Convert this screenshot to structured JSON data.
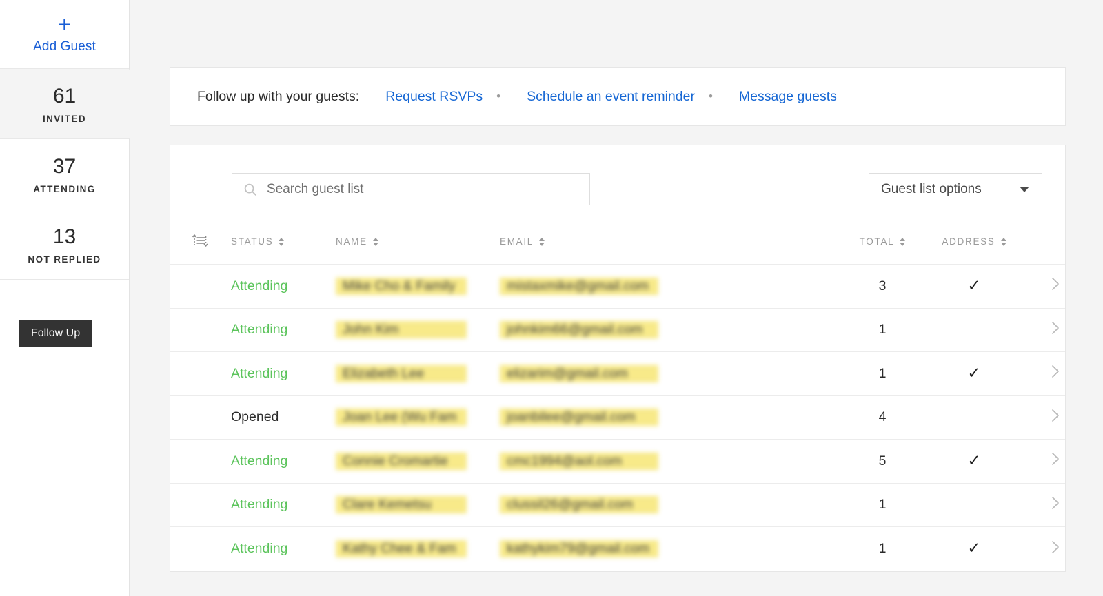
{
  "sidebar": {
    "add_guest": {
      "label": "Add Guest",
      "icon": "plus-icon",
      "color": "#1a5fd6"
    },
    "stats": [
      {
        "count": "61",
        "label": "INVITED",
        "active": true
      },
      {
        "count": "37",
        "label": "ATTENDING",
        "active": false
      },
      {
        "count": "13",
        "label": "NOT REPLIED",
        "active": false
      }
    ],
    "follow_up_button": "Follow Up"
  },
  "banner": {
    "prompt": "Follow up with your guests:",
    "separator": "•",
    "links": [
      "Request RSVPs",
      "Schedule an event reminder",
      "Message guests"
    ],
    "link_color": "#1667d4"
  },
  "controls": {
    "search_placeholder": "Search guest list",
    "search_value": "",
    "search_icon": "search-icon",
    "options_label": "Guest list options",
    "options_icon": "chevron-down-icon"
  },
  "table": {
    "sort_icon": "sort-order-icon",
    "columns": [
      {
        "label": "STATUS",
        "sortable": true
      },
      {
        "label": "NAME",
        "sortable": true
      },
      {
        "label": "EMAIL",
        "sortable": true
      },
      {
        "label": "TOTAL",
        "sortable": true
      },
      {
        "label": "ADDRESS",
        "sortable": true
      }
    ],
    "status_colors": {
      "attending": "#5cc45c",
      "opened": "#2b2b2b"
    },
    "rows": [
      {
        "status": "Attending",
        "status_type": "attending",
        "name": "Mike Cho & Family",
        "email": "mistaxmike@gmail.com",
        "total": "3",
        "address": true,
        "chevron": "chevron-right-icon"
      },
      {
        "status": "Attending",
        "status_type": "attending",
        "name": "John Kim",
        "email": "johnkim66@gmail.com",
        "total": "1",
        "address": false,
        "chevron": "chevron-right-icon"
      },
      {
        "status": "Attending",
        "status_type": "attending",
        "name": "Elizabeth Lee",
        "email": "elizarim@gmail.com",
        "total": "1",
        "address": true,
        "chevron": "chevron-right-icon"
      },
      {
        "status": "Opened",
        "status_type": "opened",
        "name": "Joan Lee (Wu Fam",
        "email": "joanbilee@gmail.com",
        "total": "4",
        "address": false,
        "chevron": "chevron-right-icon"
      },
      {
        "status": "Attending",
        "status_type": "attending",
        "name": "Connie Cromartie",
        "email": "cmc1994@aol.com",
        "total": "5",
        "address": true,
        "chevron": "chevron-right-icon"
      },
      {
        "status": "Attending",
        "status_type": "attending",
        "name": "Clare Kemetsu",
        "email": "clussil26@gmail.com",
        "total": "1",
        "address": false,
        "chevron": "chevron-right-icon"
      },
      {
        "status": "Attending",
        "status_type": "attending",
        "name": "Kathy Chee & Fam",
        "email": "kathykim79@gmail.com",
        "total": "1",
        "address": true,
        "chevron": "chevron-right-icon"
      }
    ],
    "check_glyph": "✓",
    "chevron_glyph": "›"
  }
}
